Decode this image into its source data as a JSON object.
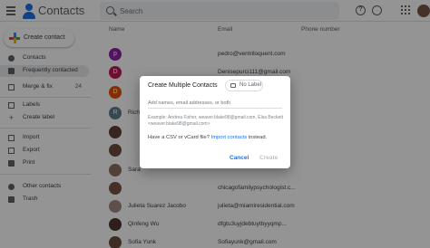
{
  "app": {
    "title": "Contacts"
  },
  "search": {
    "placeholder": "Search"
  },
  "sidebar": {
    "create_label": "Create contact",
    "items": [
      {
        "label": "Contacts",
        "count": ""
      },
      {
        "label": "Frequently contacted",
        "count": ""
      },
      {
        "label": "Merge & fix",
        "count": "24"
      },
      {
        "label": "Labels",
        "count": ""
      },
      {
        "label": "Create label",
        "count": ""
      },
      {
        "label": "Import",
        "count": ""
      },
      {
        "label": "Export",
        "count": ""
      },
      {
        "label": "Print",
        "count": ""
      },
      {
        "label": "Other contacts",
        "count": ""
      },
      {
        "label": "Trash",
        "count": ""
      }
    ]
  },
  "table": {
    "headers": {
      "name": "Name",
      "email": "Email",
      "phone": "Phone number"
    },
    "rows": [
      {
        "initial": "p",
        "name": "",
        "email": "pedro@ventriloquent.com",
        "color": "#8e24aa"
      },
      {
        "initial": "D",
        "name": "",
        "email": "Denisepurci111@gmail.com",
        "color": "#c2185b"
      },
      {
        "initial": "D",
        "name": "",
        "email": "",
        "color": "#e65100"
      },
      {
        "initial": "R",
        "name": "Richa",
        "email": "",
        "color": "#607d8b"
      },
      {
        "initial": "",
        "name": "",
        "email": "",
        "color": "#5d4037"
      },
      {
        "initial": "",
        "name": "",
        "email": "",
        "color": "#6d4c41"
      },
      {
        "initial": "",
        "name": "Sara",
        "email": "",
        "color": "#8d6e63"
      },
      {
        "initial": "",
        "name": "",
        "email": "chicagofamilypsychologist.c...",
        "color": "#795548"
      },
      {
        "initial": "",
        "name": "Julieta Suarez Jacobo",
        "email": "julieta@miamiresidential.com",
        "color": "#a1887f"
      },
      {
        "initial": "",
        "name": "Qinfeng Wu",
        "email": "dfgtu3uyjdebtuytbyyqmp...",
        "color": "#4e342e"
      },
      {
        "initial": "",
        "name": "Sofia Yunk",
        "email": "Sofiayunk@gmail.com",
        "color": "#6d4c41"
      }
    ]
  },
  "dialog": {
    "title": "Create Multiple Contacts",
    "chip_label": "No Label",
    "input_placeholder": "Add names, email addresses, or both",
    "example": "Example: Andrea Fisher, weaver.blake98@gmail.com, Elsa Beckett <weaver.blake98@gmail.com>",
    "import_text": "Have a CSV or vCard file? ",
    "import_link": "Import contacts",
    "import_suffix": " instead.",
    "cancel_label": "Cancel",
    "create_label": "Create"
  }
}
